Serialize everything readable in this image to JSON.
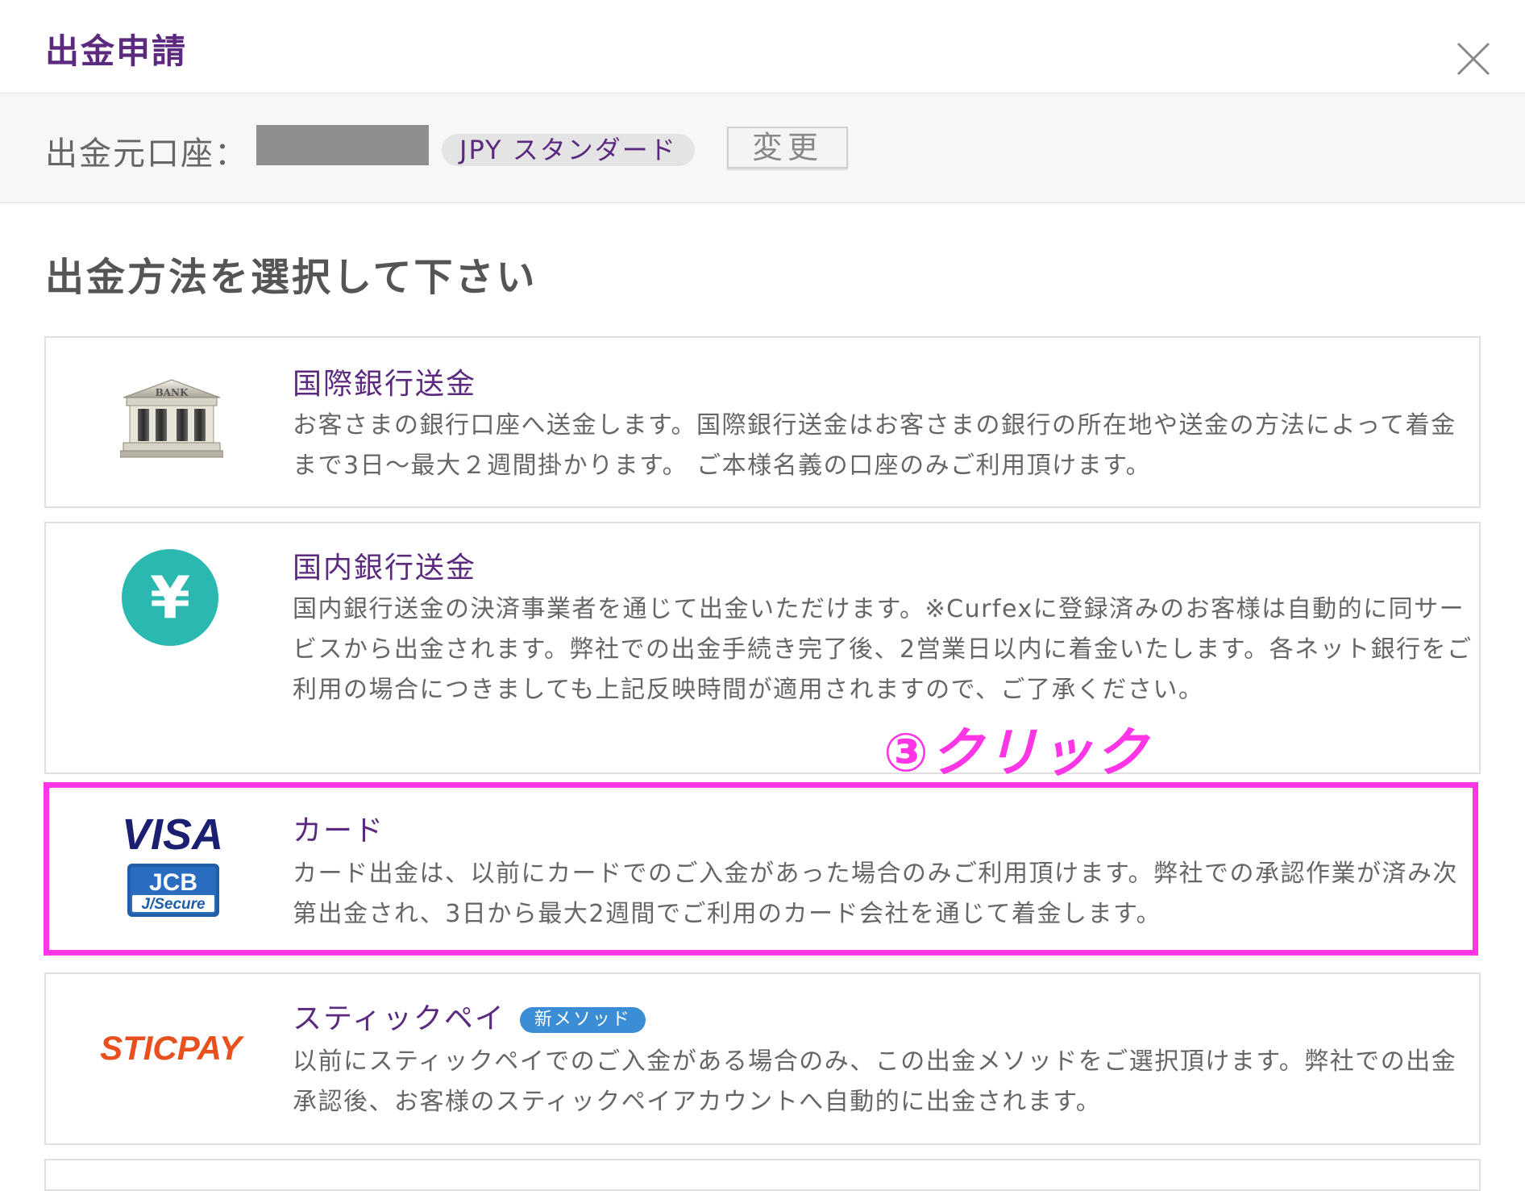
{
  "dialog": {
    "title": "出金申請",
    "close_icon": "close-icon"
  },
  "account": {
    "label": "出金元口座：",
    "account_type": "JPY スタンダード",
    "change_button": "変更"
  },
  "section": {
    "heading": "出金方法を選択して下さい"
  },
  "methods": [
    {
      "icon": "bank-building-icon",
      "logo_text": "BANK",
      "title": "国際銀行送金",
      "description": "お客さまの銀行口座へ送金します。国際銀行送金はお客さまの銀行の所在地や送金の方法によって着金まで3日〜最大２週間掛かります。 ご本様名義の口座のみご利用頂けます。"
    },
    {
      "icon": "yen-circle-icon",
      "logo_text": "¥",
      "title": "国内銀行送金",
      "description": "国内銀行送金の決済事業者を通じて出金いただけます。※Curfexに登録済みのお客様は自動的に同サービスから出金されます。弊社での出金手続き完了後、2営業日以内に着金いたします。各ネット銀行をご利用の場合につきましても上記反映時間が適用されますので、ご了承ください。"
    },
    {
      "icon": "visa-jcb-logo-icon",
      "logo_text": "VISA",
      "logo_text_2": "JCB",
      "logo_text_3": "J/Secure",
      "title": "カード",
      "description": "カード出金は、以前にカードでのご入金があった場合のみご利用頂けます。弊社での承認作業が済み次第出金され、3日から最大2週間でご利用のカード会社を通じて着金します。"
    },
    {
      "icon": "sticpay-logo-icon",
      "logo_text": "STICPAY",
      "title": "スティックペイ",
      "badge": "新メソッド",
      "description": "以前にスティックペイでのご入金がある場合のみ、この出金メソッドをご選択頂けます。弊社での出金承認後、お客様のスティックペイアカウントへ自動的に出金されます。"
    }
  ],
  "annotation": {
    "text": "③クリック",
    "color": "#ff35e6"
  },
  "colors": {
    "brand_purple": "#5b2a7e",
    "highlight_magenta": "#ff35e6",
    "yen_teal": "#2bb8b0",
    "badge_blue": "#3b8ed6",
    "sticpay_orange": "#e8501d",
    "visa_navy": "#1a1f71"
  }
}
